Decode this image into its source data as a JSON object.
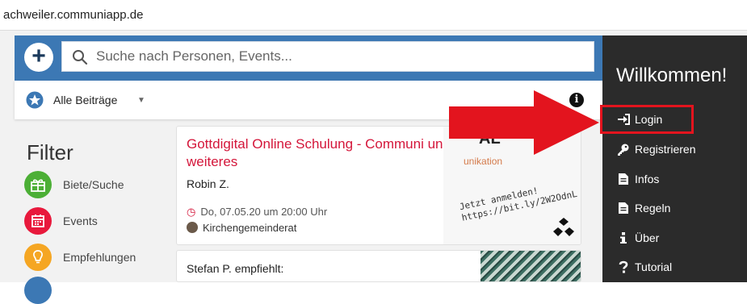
{
  "browser": {
    "url": "achweiler.communiapp.de"
  },
  "appbar": {
    "add_icon": "plus-icon",
    "search_icon": "search-icon",
    "search_placeholder": "Suche nach Personen, Events..."
  },
  "subbar": {
    "star_icon": "star-icon",
    "dropdown_label": "Alle Beiträge",
    "caret_icon": "caret-down-icon",
    "info_icon": "info-icon"
  },
  "filter": {
    "title": "Filter",
    "categories": [
      {
        "label": "Biete/Suche",
        "color": "#4caf36",
        "icon": "gift-icon"
      },
      {
        "label": "Events",
        "color": "#e8193c",
        "icon": "calendar-icon"
      },
      {
        "label": "Empfehlungen",
        "color": "#f5a623",
        "icon": "lightbulb-icon"
      }
    ]
  },
  "posts": [
    {
      "title": "Gottdigital Online Schulung - Communi und weiteres",
      "author": "Robin Z.",
      "date": "Do, 07.05.20 um 20:00 Uhr",
      "group": "Kirchengemeinderat",
      "promo_big": "AL",
      "promo_small": "unikation",
      "promo_text_1": "Jetzt anmelden!",
      "promo_text_2": "https://bit.ly/2W2OdnL"
    },
    {
      "author": "Stefan P.",
      "action": "empfiehlt:"
    }
  ],
  "sidebar": {
    "welcome": "Willkommen!",
    "items": [
      {
        "label": "Login",
        "icon": "sign-in-icon"
      },
      {
        "label": "Registrieren",
        "icon": "key-icon"
      },
      {
        "label": "Infos",
        "icon": "document-icon"
      },
      {
        "label": "Regeln",
        "icon": "document-icon"
      },
      {
        "label": "Über",
        "icon": "info-icon"
      },
      {
        "label": "Tutorial",
        "icon": "question-icon"
      }
    ]
  },
  "colors": {
    "accent": "#3c78b4",
    "brand_red": "#d4163a",
    "sidebar_bg": "#2b2b2b",
    "highlight": "#e3141e"
  }
}
